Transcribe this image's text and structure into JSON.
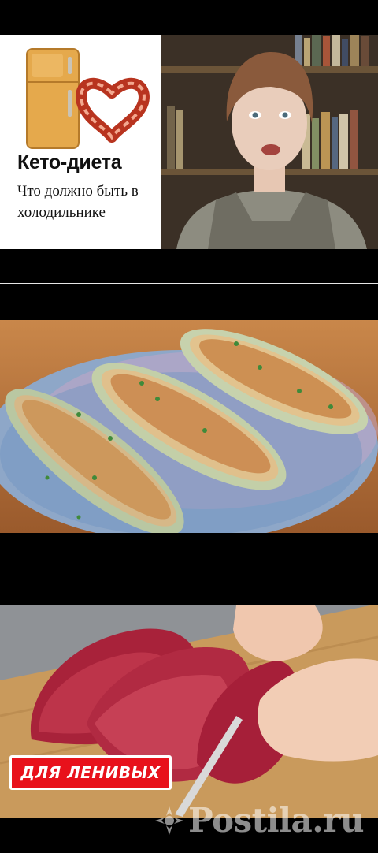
{
  "thumbnails": [
    {
      "id": "keto",
      "title": "Кето-диета",
      "subtitle": "Что должно быть в холодильнике"
    },
    {
      "id": "zucchini"
    },
    {
      "id": "meat",
      "badge": "ДЛЯ ЛЕНИВЫХ"
    }
  ],
  "watermark": {
    "text": "Postila.ru",
    "icon": "postila-logo-icon"
  },
  "colors": {
    "background": "#000000",
    "badge": "#e8111b",
    "divider": "#e6e6e6"
  }
}
